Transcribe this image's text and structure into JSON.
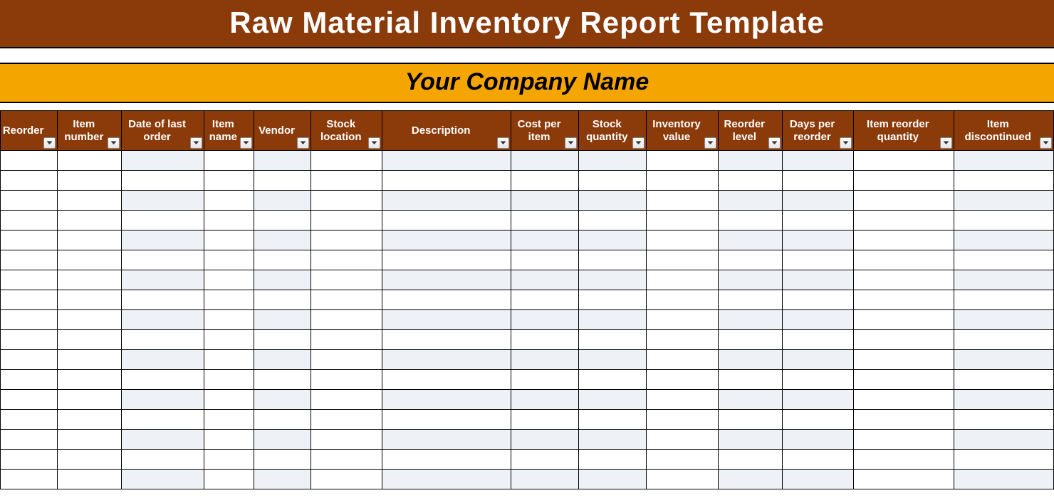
{
  "header": {
    "title": "Raw Material Inventory Report Template",
    "subtitle": "Your Company Name"
  },
  "table": {
    "columns": [
      "Reorder",
      "Item number",
      "Date of last order",
      "Item name",
      "Vendor",
      "Stock location",
      "Description",
      "Cost per item",
      "Stock quantity",
      "Inventory value",
      "Reorder level",
      "Days per reorder",
      "Item reorder quantity",
      "Item discontinued"
    ],
    "banded_column_indices": [
      3,
      5,
      7,
      8,
      9,
      11,
      12,
      14
    ],
    "row_count": 17,
    "rows": []
  }
}
